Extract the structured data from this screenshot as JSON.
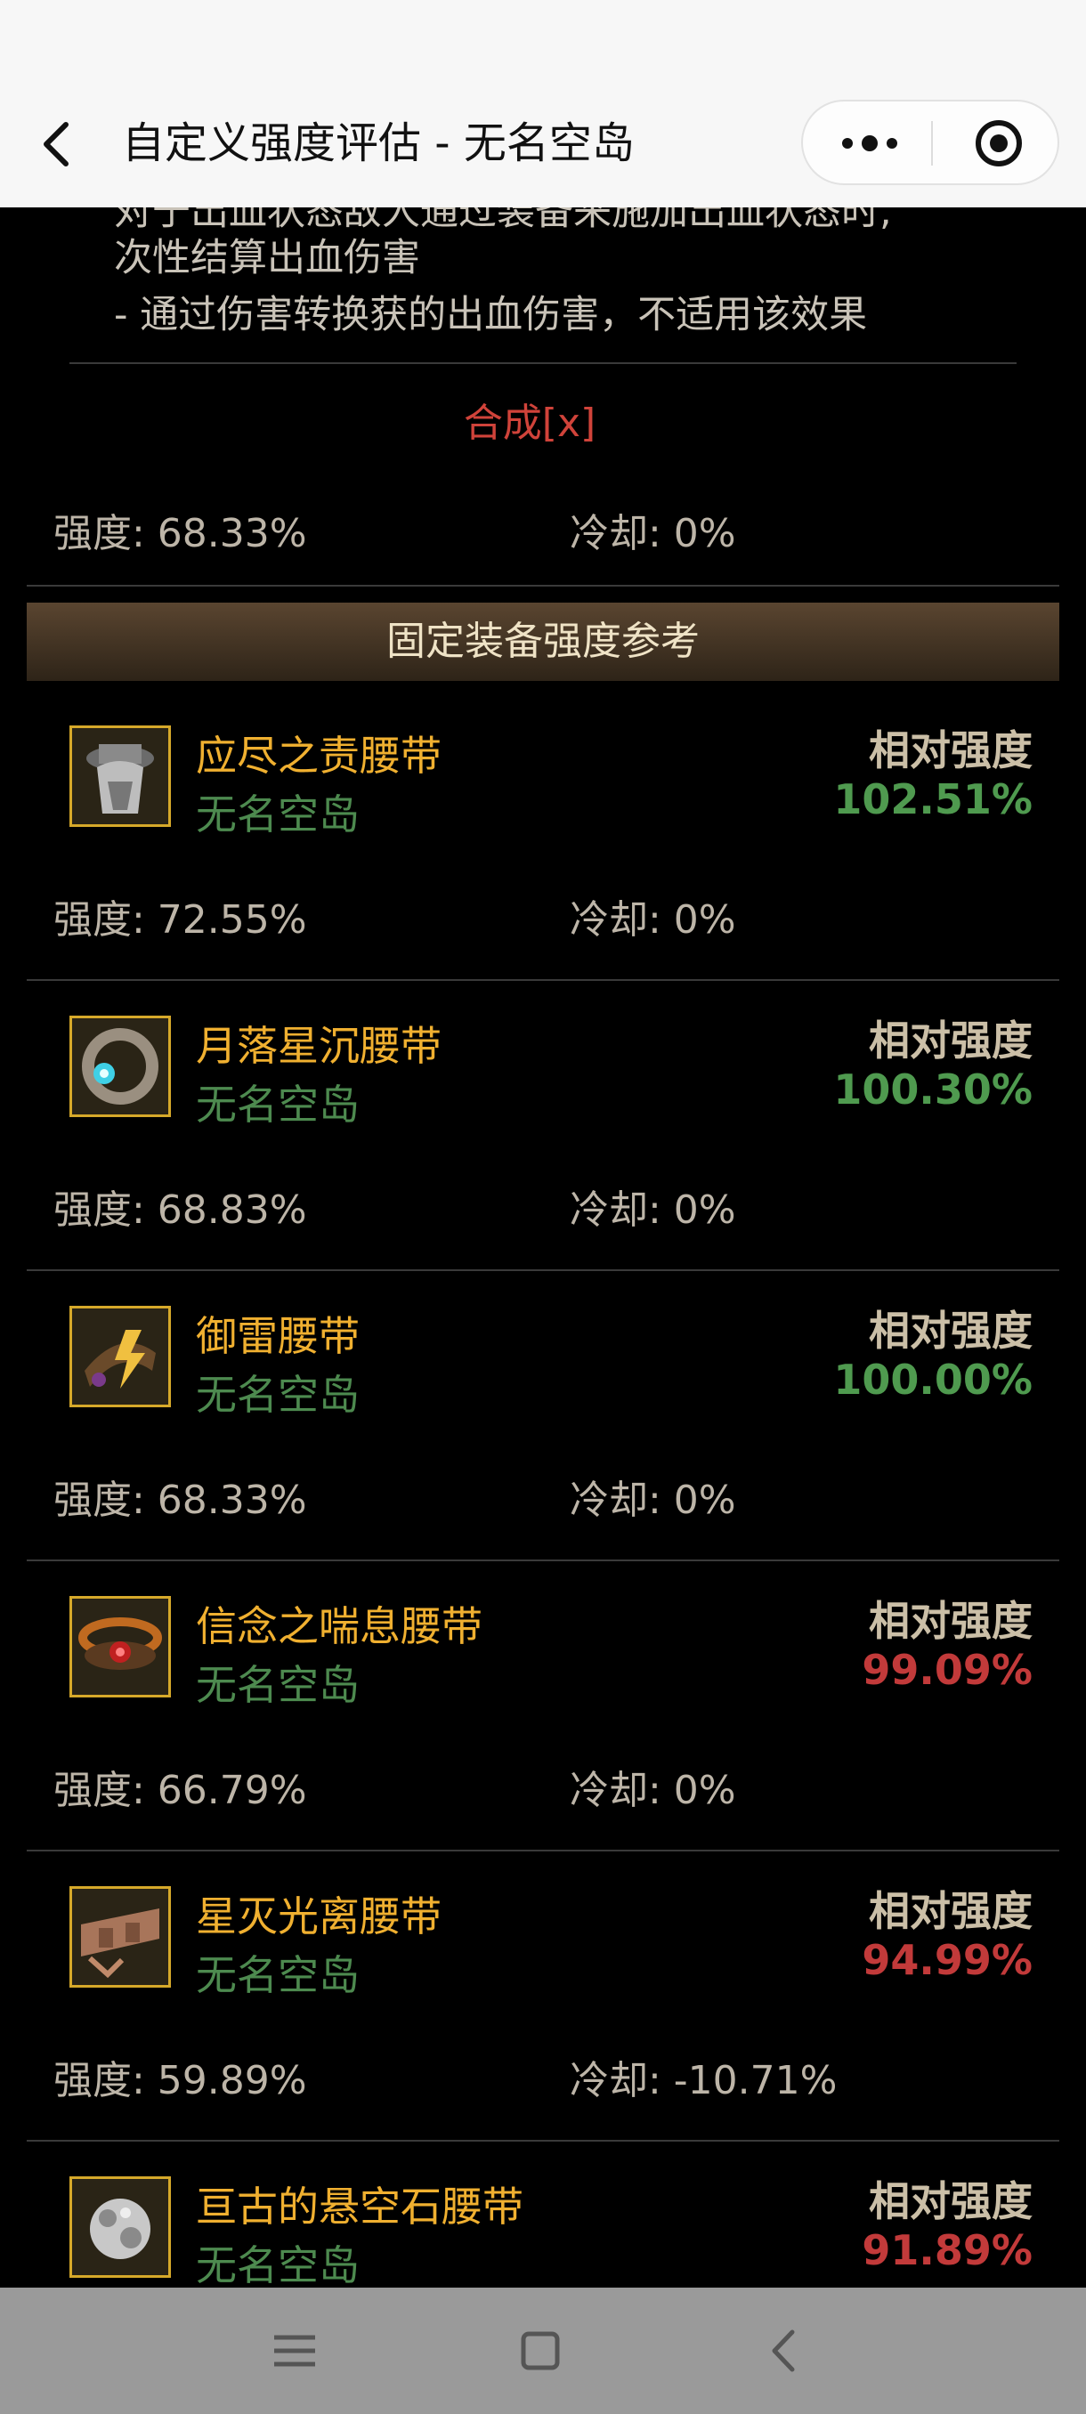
{
  "header": {
    "title": "自定义强度评估 - 无名空岛",
    "back_icon": "chevron-left-icon",
    "more_icon": "more-dots-icon",
    "close_icon": "target-circle-icon"
  },
  "description": {
    "lines": [
      "对于出血状态敌人通过装备来施加出血状态时,",
      "次性结算出血伤害",
      "- 通过伤害转换获的出血伤害，不适用该效果"
    ]
  },
  "compose_link": "合成[x]",
  "base_stats": {
    "strength": "强度: 68.33%",
    "cooldown": "冷却: 0%"
  },
  "section_title": "固定装备强度参考",
  "items": [
    {
      "name": "应尽之责腰带",
      "origin": "无名空岛",
      "rel_label": "相对强度",
      "rel_value": "102.51%",
      "trend": "up",
      "strength": "强度: 72.55%",
      "cooldown": "冷却: 0%",
      "icon": "hat-belt-icon"
    },
    {
      "name": "月落星沉腰带",
      "origin": "无名空岛",
      "rel_label": "相对强度",
      "rel_value": "100.30%",
      "trend": "up",
      "strength": "强度: 68.83%",
      "cooldown": "冷却: 0%",
      "icon": "ring-belt-icon"
    },
    {
      "name": "御雷腰带",
      "origin": "无名空岛",
      "rel_label": "相对强度",
      "rel_value": "100.00%",
      "trend": "up",
      "strength": "强度: 68.33%",
      "cooldown": "冷却: 0%",
      "icon": "thunder-belt-icon"
    },
    {
      "name": "信念之喘息腰带",
      "origin": "无名空岛",
      "rel_label": "相对强度",
      "rel_value": "99.09%",
      "trend": "down",
      "strength": "强度: 66.79%",
      "cooldown": "冷却: 0%",
      "icon": "faith-belt-icon"
    },
    {
      "name": "星灭光离腰带",
      "origin": "无名空岛",
      "rel_label": "相对强度",
      "rel_value": "94.99%",
      "trend": "down",
      "strength": "强度: 59.89%",
      "cooldown": "冷却: -10.71%",
      "icon": "leather-belt-icon"
    },
    {
      "name": "亘古的悬空石腰带",
      "origin": "无名空岛",
      "rel_label": "相对强度",
      "rel_value": "91.89%",
      "trend": "down",
      "strength": "",
      "cooldown": "",
      "icon": "stone-belt-icon"
    }
  ],
  "system_nav": {
    "menu_icon": "menu-lines-icon",
    "home_icon": "square-home-icon",
    "back_icon": "back-triangle-icon"
  },
  "colors": {
    "accent_red": "#d0433a",
    "item_name": "#f0b030",
    "origin_green": "#4d8a4f",
    "up_green": "#4f9a4f",
    "down_red": "#c23a3a"
  }
}
